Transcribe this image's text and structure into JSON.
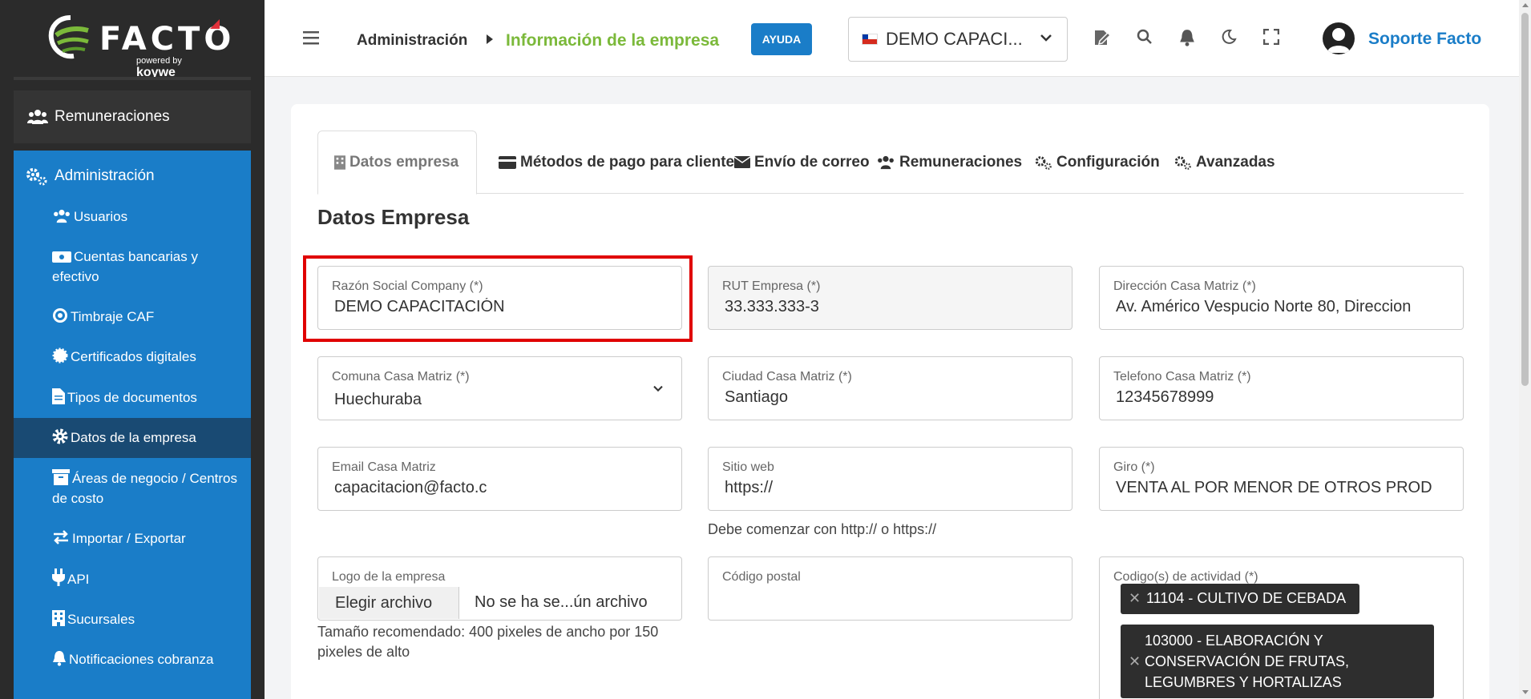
{
  "brand": {
    "name": "FACTO",
    "powered": "powered",
    "by": "by",
    "partner": "koywe"
  },
  "sidebar": {
    "remuneraciones": "Remuneraciones",
    "administracion": "Administración",
    "items": [
      {
        "label": "Usuarios",
        "icon": "users-icon"
      },
      {
        "label": "Cuentas bancarias y efectivo",
        "icon": "money-icon"
      },
      {
        "label": "Timbraje CAF",
        "icon": "target-icon"
      },
      {
        "label": "Certificados digitales",
        "icon": "certificate-icon"
      },
      {
        "label": "Tipos de documentos",
        "icon": "file-icon"
      },
      {
        "label": "Datos de la empresa",
        "icon": "gear-icon",
        "active": true
      },
      {
        "label": "Áreas de negocio / Centros de costo",
        "icon": "archive-icon"
      },
      {
        "label": "Importar / Exportar",
        "icon": "exchange-icon"
      },
      {
        "label": "API",
        "icon": "plug-icon"
      },
      {
        "label": "Sucursales",
        "icon": "building-icon"
      },
      {
        "label": "Notificaciones cobranza",
        "icon": "bell-icon"
      }
    ]
  },
  "topbar": {
    "breadcrumb": "Administración",
    "page": "Información de la empresa",
    "help": "AYUDA",
    "company": "DEMO CAPACI...",
    "user": "Soporte Facto"
  },
  "tabs": [
    {
      "label": "Datos empresa",
      "icon": "building-icon",
      "active": true
    },
    {
      "label": "Métodos de pago para clientes",
      "icon": "credit-card-icon"
    },
    {
      "label": "Envío de correo",
      "icon": "envelope-icon"
    },
    {
      "label": "Remuneraciones",
      "icon": "users-icon"
    },
    {
      "label": "Configuración",
      "icon": "gears-icon"
    },
    {
      "label": "Avanzadas",
      "icon": "gears-icon"
    }
  ],
  "section_title": "Datos Empresa",
  "fields": {
    "razon_social": {
      "label": "Razón Social Company (*)",
      "value": "DEMO CAPACITACIÓN"
    },
    "rut": {
      "label": "RUT Empresa (*)",
      "value": "33.333.333-3"
    },
    "direccion": {
      "label": "Dirección Casa Matriz (*)",
      "value": "Av. Américo Vespucio Norte 80, Direccion"
    },
    "comuna": {
      "label": "Comuna Casa Matriz (*)",
      "value": "Huechuraba"
    },
    "ciudad": {
      "label": "Ciudad Casa Matriz (*)",
      "value": "Santiago"
    },
    "telefono": {
      "label": "Telefono Casa Matriz (*)",
      "value": "12345678999"
    },
    "email": {
      "label": "Email Casa Matriz",
      "value": "capacitacion@facto.c"
    },
    "sitio_web": {
      "label": "Sitio web",
      "value": "https://",
      "hint": "Debe comenzar con http:// o https://"
    },
    "giro": {
      "label": "Giro (*)",
      "value": "VENTA AL POR MENOR DE OTROS PROD"
    },
    "logo": {
      "label": "Logo de la empresa",
      "button": "Elegir archivo",
      "file": "No se ha se...ún archivo",
      "hint": "Tamaño recomendado: 400 pixeles de ancho por 150 pixeles de alto"
    },
    "codigo_postal": {
      "label": "Código postal",
      "value": ""
    },
    "actividad": {
      "label": "Codigo(s) de actividad (*)",
      "chips": [
        "11104 - CULTIVO DE CEBADA",
        "103000 - ELABORACIÓN Y CONSERVACIÓN DE FRUTAS, LEGUMBRES Y HORTALIZAS"
      ]
    }
  },
  "colors": {
    "primary": "#1a7dc8",
    "accent_green": "#7bb93a",
    "sidebar_dark": "#2b2b2b",
    "active_item": "#194a73",
    "highlight": "#e00000"
  }
}
